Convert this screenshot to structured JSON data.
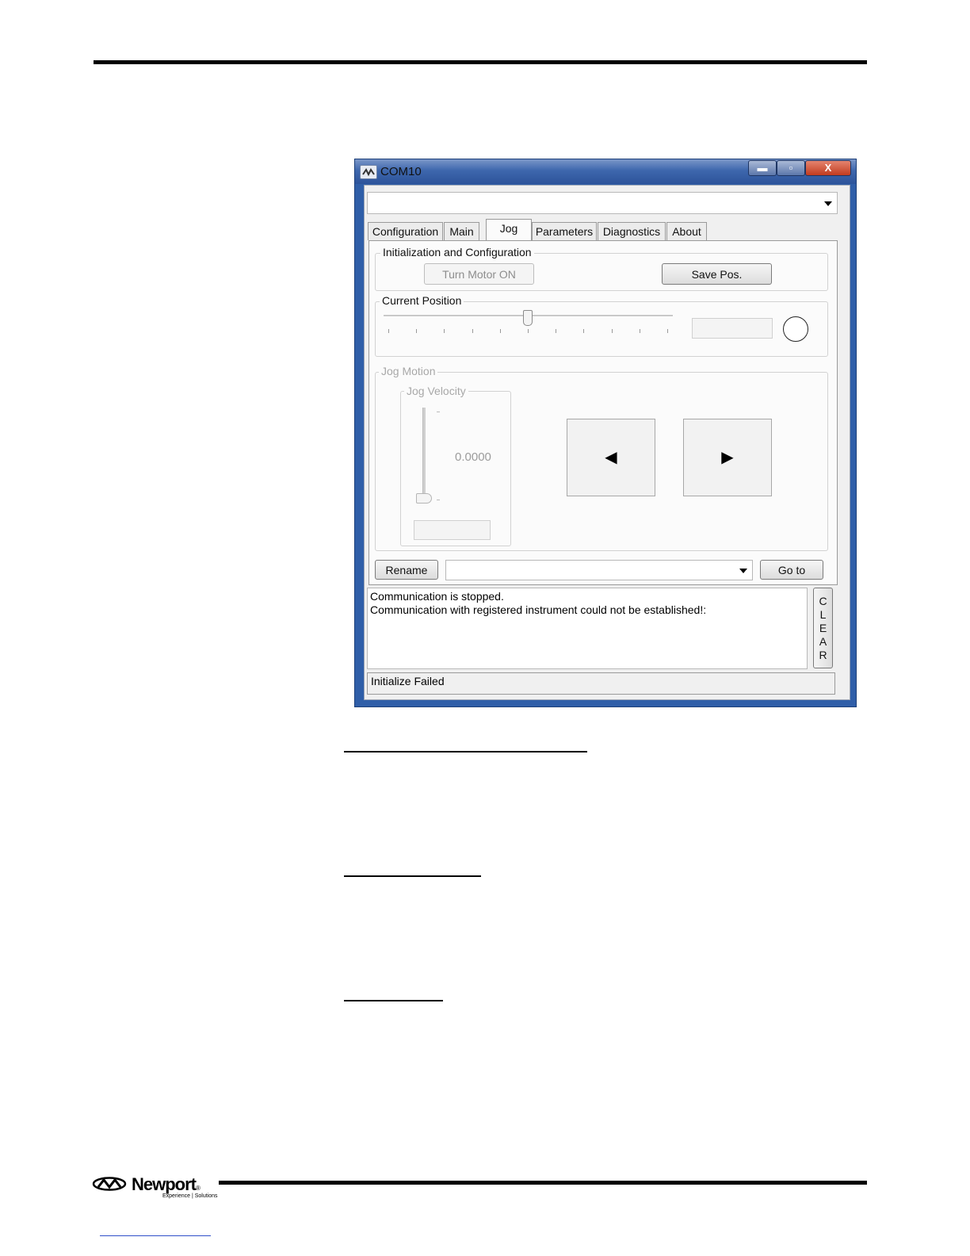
{
  "window": {
    "title": "COM10",
    "controls": {
      "minimize": "▬",
      "maximize": "▫",
      "close": "X"
    }
  },
  "tabs": [
    {
      "label": "Configuration",
      "active": false
    },
    {
      "label": "Main",
      "active": false
    },
    {
      "label": "Jog",
      "active": true
    },
    {
      "label": "Parameters",
      "active": false
    },
    {
      "label": "Diagnostics",
      "active": false
    },
    {
      "label": "About",
      "active": false
    }
  ],
  "init_group": {
    "label": "Initialization and Configuration",
    "turn_motor_label": "Turn Motor ON",
    "save_pos_label": "Save Pos."
  },
  "position_group": {
    "label": "Current Position",
    "slider_fraction": 0.5
  },
  "jog_motion": {
    "label": "Jog Motion",
    "velocity_label": "Jog Velocity",
    "velocity_value": "0.0000",
    "left_arrow": "◀",
    "right_arrow": "▶"
  },
  "bottom_bar": {
    "rename_label": "Rename",
    "goto_label": "Go to"
  },
  "log": {
    "lines": [
      "Communication is stopped.",
      "Communication with registered instrument could not be established!:"
    ],
    "clear_letters": [
      "C",
      "L",
      "E",
      "A",
      "R"
    ]
  },
  "status_text": "Initialize Failed",
  "footer": {
    "logo_text": "Newport",
    "tagline": "Experience | Solutions",
    "registered_mark": "®"
  }
}
